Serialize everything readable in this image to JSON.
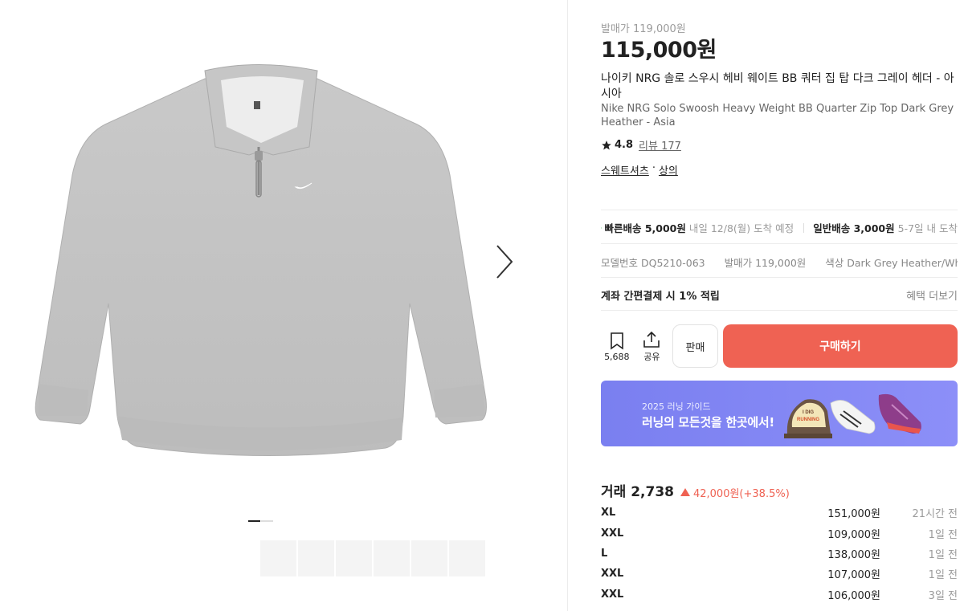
{
  "product": {
    "release_price_text": "발매가 119,000원",
    "price": "115,000원",
    "title_ko": "나이키 NRG 솔로 스우시 헤비 웨이트 BB 쿼터 집 탑 다크 그레이 헤더 - 아시아",
    "title_en": "Nike NRG Solo Swoosh Heavy Weight BB Quarter Zip Top Dark Grey Heather - Asia",
    "rating": "4.8",
    "review_text": "리뷰 177",
    "category_1": "스웨트셔츠",
    "category_sep": "·",
    "category_2": "상의"
  },
  "shipping": {
    "fast_label": "빠른배송 5,000원",
    "fast_eta": "내일 12/8(월) 도착 예정",
    "normal_label": "일반배송 3,000원",
    "normal_eta": "5-7일 내 도착"
  },
  "meta": {
    "model": "모델번호 DQ5210-063",
    "release": "발매가 119,000원",
    "color": "색상 Dark Grey Heather/White"
  },
  "benefit": {
    "title": "계좌 간편결제 시 1% 적립",
    "more": "혜택 더보기"
  },
  "actions": {
    "bookmark_count": "5,688",
    "share_label": "공유",
    "sell_label": "판매",
    "buy_label": "구매하기"
  },
  "banner": {
    "subtitle": "2025 러닝 가이드",
    "title": "러닝의 모든것을 한곳에서!",
    "cap_text_line1": "I DIG",
    "cap_text_line2": "RUNNING"
  },
  "trades": {
    "count_label": "거래 2,738",
    "change": "42,000원(+38.5%)",
    "rows": [
      {
        "size": "XL",
        "price": "151,000원",
        "ago": "21시간 전"
      },
      {
        "size": "XXL",
        "price": "109,000원",
        "ago": "1일 전"
      },
      {
        "size": "L",
        "price": "138,000원",
        "ago": "1일 전"
      },
      {
        "size": "XXL",
        "price": "107,000원",
        "ago": "1일 전"
      },
      {
        "size": "XXL",
        "price": "106,000원",
        "ago": "3일 전"
      }
    ]
  },
  "gallery": {
    "thumb_count": 6
  },
  "colors": {
    "accent": "#ef6253",
    "banner": "#7a7ff0",
    "fast_icon": "#2ec14d"
  }
}
